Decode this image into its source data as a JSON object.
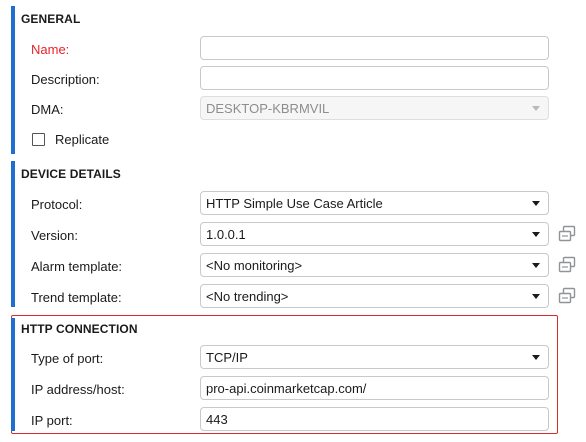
{
  "general": {
    "title": "GENERAL",
    "name_label": "Name:",
    "name_value": "",
    "description_label": "Description:",
    "description_value": "",
    "dma_label": "DMA:",
    "dma_value": "DESKTOP-KBRMVIL",
    "replicate_label": "Replicate",
    "replicate_checked": false
  },
  "device_details": {
    "title": "DEVICE DETAILS",
    "protocol_label": "Protocol:",
    "protocol_value": "HTTP Simple Use Case Article",
    "version_label": "Version:",
    "version_value": "1.0.0.1",
    "alarm_label": "Alarm template:",
    "alarm_value": "<No monitoring>",
    "trend_label": "Trend template:",
    "trend_value": "<No trending>"
  },
  "http_connection": {
    "title": "HTTP CONNECTION",
    "port_type_label": "Type of port:",
    "port_type_value": "TCP/IP",
    "ip_label": "IP address/host:",
    "ip_value": "pro-api.coinmarketcap.com/",
    "ip_port_label": "IP port:",
    "ip_port_value": "443"
  },
  "colors": {
    "accent_bar": "#1f6fd1",
    "required_label": "#e8232b",
    "highlight_border": "#d62b2b"
  },
  "icons": {
    "copy": "copy-icon",
    "dropdown": "chevron-down-icon"
  }
}
